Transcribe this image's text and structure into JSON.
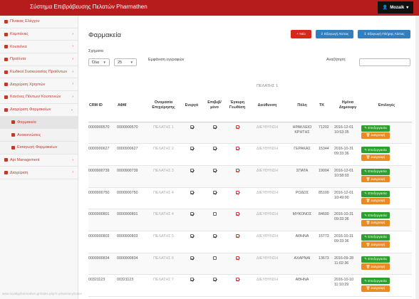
{
  "app": {
    "title": "Σύστημα Επιβράβευσης Πελατών Pharmathen",
    "user": "Mozaik"
  },
  "sidebar": {
    "items": [
      {
        "label": "Πίνακας Ελέγχου",
        "arrow": ""
      },
      {
        "label": "Καμπάνιες",
        "arrow": "›"
      },
      {
        "label": "Κουπόνια",
        "arrow": "›"
      },
      {
        "label": "Προϊόντα",
        "arrow": "›"
      },
      {
        "label": "Κωδικοί Συσκευασίας Προϊόντων",
        "arrow": "›"
      },
      {
        "label": "Διαχείριση Χρηστών",
        "arrow": "›"
      },
      {
        "label": "Κανόνες Πόντων/ Κουπονιών",
        "arrow": "›"
      },
      {
        "label": "Διαχείριση Φαρμακείων",
        "arrow": "⌄"
      },
      {
        "label": "Φαρμακεία",
        "arrow": ""
      },
      {
        "label": "Ανακοινώσεις",
        "arrow": ""
      },
      {
        "label": "Εισαγωγή Φαρμακείων",
        "arrow": ""
      },
      {
        "label": "Api Management",
        "arrow": "›"
      },
      {
        "label": "Διαχείριση",
        "arrow": "›"
      }
    ]
  },
  "page": {
    "title": "Φαρμακεία",
    "btn_new": "+ Νέο",
    "btn_export": "⇓ Εξαγωγή Λίστας",
    "btn_export_full": "⇓ Εξαγωγή Πλήρης Λίστας",
    "schema_label": "Σχήματα",
    "schema_value": "Όλα",
    "page_size": "25",
    "show_records": "Εμφάνιση εγγραφών",
    "search_label": "Αναζήτηση",
    "group_header": "ΠΕΛΑΤΗΣ 1"
  },
  "table": {
    "headers": [
      "CRM ID",
      "ΑΦΜ",
      "Ονομασία Επιχείρησης",
      "Ενεργό",
      "Επιβεβ/μένο",
      "Έγκυρη Γεωθέση",
      "Διεύθυνση",
      "Πόλη",
      "ΤΚ",
      "Ημ/νια Δημιουργ",
      "Επιλογές"
    ],
    "rows": [
      {
        "crm": "0000900570",
        "afm": "0000900570",
        "name": "ΠΕΛΑΤΗΣ 1",
        "active": true,
        "verified": true,
        "geo": true,
        "address": "ΔΙΕΥΘΥΝΣΗ",
        "city": "ΗΡΑΚΛΕΙΟ ΚΡΗΤΗΣ",
        "zip": "71202",
        "date": "2016-12-01 10:53:35"
      },
      {
        "crm": "0000900627",
        "afm": "0000900627",
        "name": "ΠΕΛΑΤΗΣ 2",
        "active": true,
        "verified": true,
        "geo": true,
        "address": "ΔΙΕΥΘΥΝΣΗ",
        "city": "ΓΕΡΑΚΑΣ",
        "zip": "15344",
        "date": "2016-10-31 09:33:36"
      },
      {
        "crm": "0000900739",
        "afm": "0000900739",
        "name": "ΠΕΛΑΤΗΣ 3",
        "active": true,
        "verified": true,
        "geo": true,
        "address": "ΔΙΕΥΘΥΝΣΗ",
        "city": "ΣΠΑΤΑ",
        "zip": "19004",
        "date": "2016-12-01 10:58:03"
      },
      {
        "crm": "0000900750",
        "afm": "0000900750",
        "name": "ΠΕΛΑΤΗΣ 4",
        "active": true,
        "verified": true,
        "geo": true,
        "address": "ΔΙΕΥΘΥΝΣΗ",
        "city": "ΡΟΔΟΣ",
        "zip": "85100",
        "date": "2016-12-01 10:49:00"
      },
      {
        "crm": "0000900801",
        "afm": "0000900801",
        "name": "ΠΕΛΑΤΗΣ 4",
        "active": true,
        "verified": false,
        "geo": true,
        "address": "ΔΙΕΥΘΥΝΣΗ",
        "city": "ΜΥΚΟΝΟΣ",
        "zip": "84600",
        "date": "2016-10-31 09:33:36"
      },
      {
        "crm": "0000900803",
        "afm": "0000900803",
        "name": "ΠΕΛΑΤΗΣ 5",
        "active": true,
        "verified": true,
        "geo": true,
        "address": "ΔΙΕΥΘΥΝΣΗ",
        "city": "ΑΘΗΝΑ",
        "zip": "15773",
        "date": "2016-10-31 09:33:36"
      },
      {
        "crm": "0000900834",
        "afm": "0000900834",
        "name": "ΠΕΛΑΤΗΣ 6",
        "active": true,
        "verified": false,
        "geo": true,
        "address": "ΔΙΕΥΘΥΝΣΗ",
        "city": "ΑΧΑΡΝΑΙ",
        "zip": "13673",
        "date": "2016-09-28 11:02:36"
      },
      {
        "crm": "00321123",
        "afm": "00321123",
        "name": "ΠΕΛΑΤΗΣ 7",
        "active": true,
        "verified": true,
        "geo": true,
        "address": "ΔΙΕΥΘΥΝΣΗ",
        "city": "ΑΘΗΝΑ",
        "zip": "",
        "date": "2016-10-10 11:10:29"
      }
    ],
    "edit_label": "✎ Επεξεργασία",
    "delete_label": "🗑 Διαγραφή"
  },
  "statusbar": "www.loyaltypharmathen.gr/index.php?r=pharmacy/index"
}
